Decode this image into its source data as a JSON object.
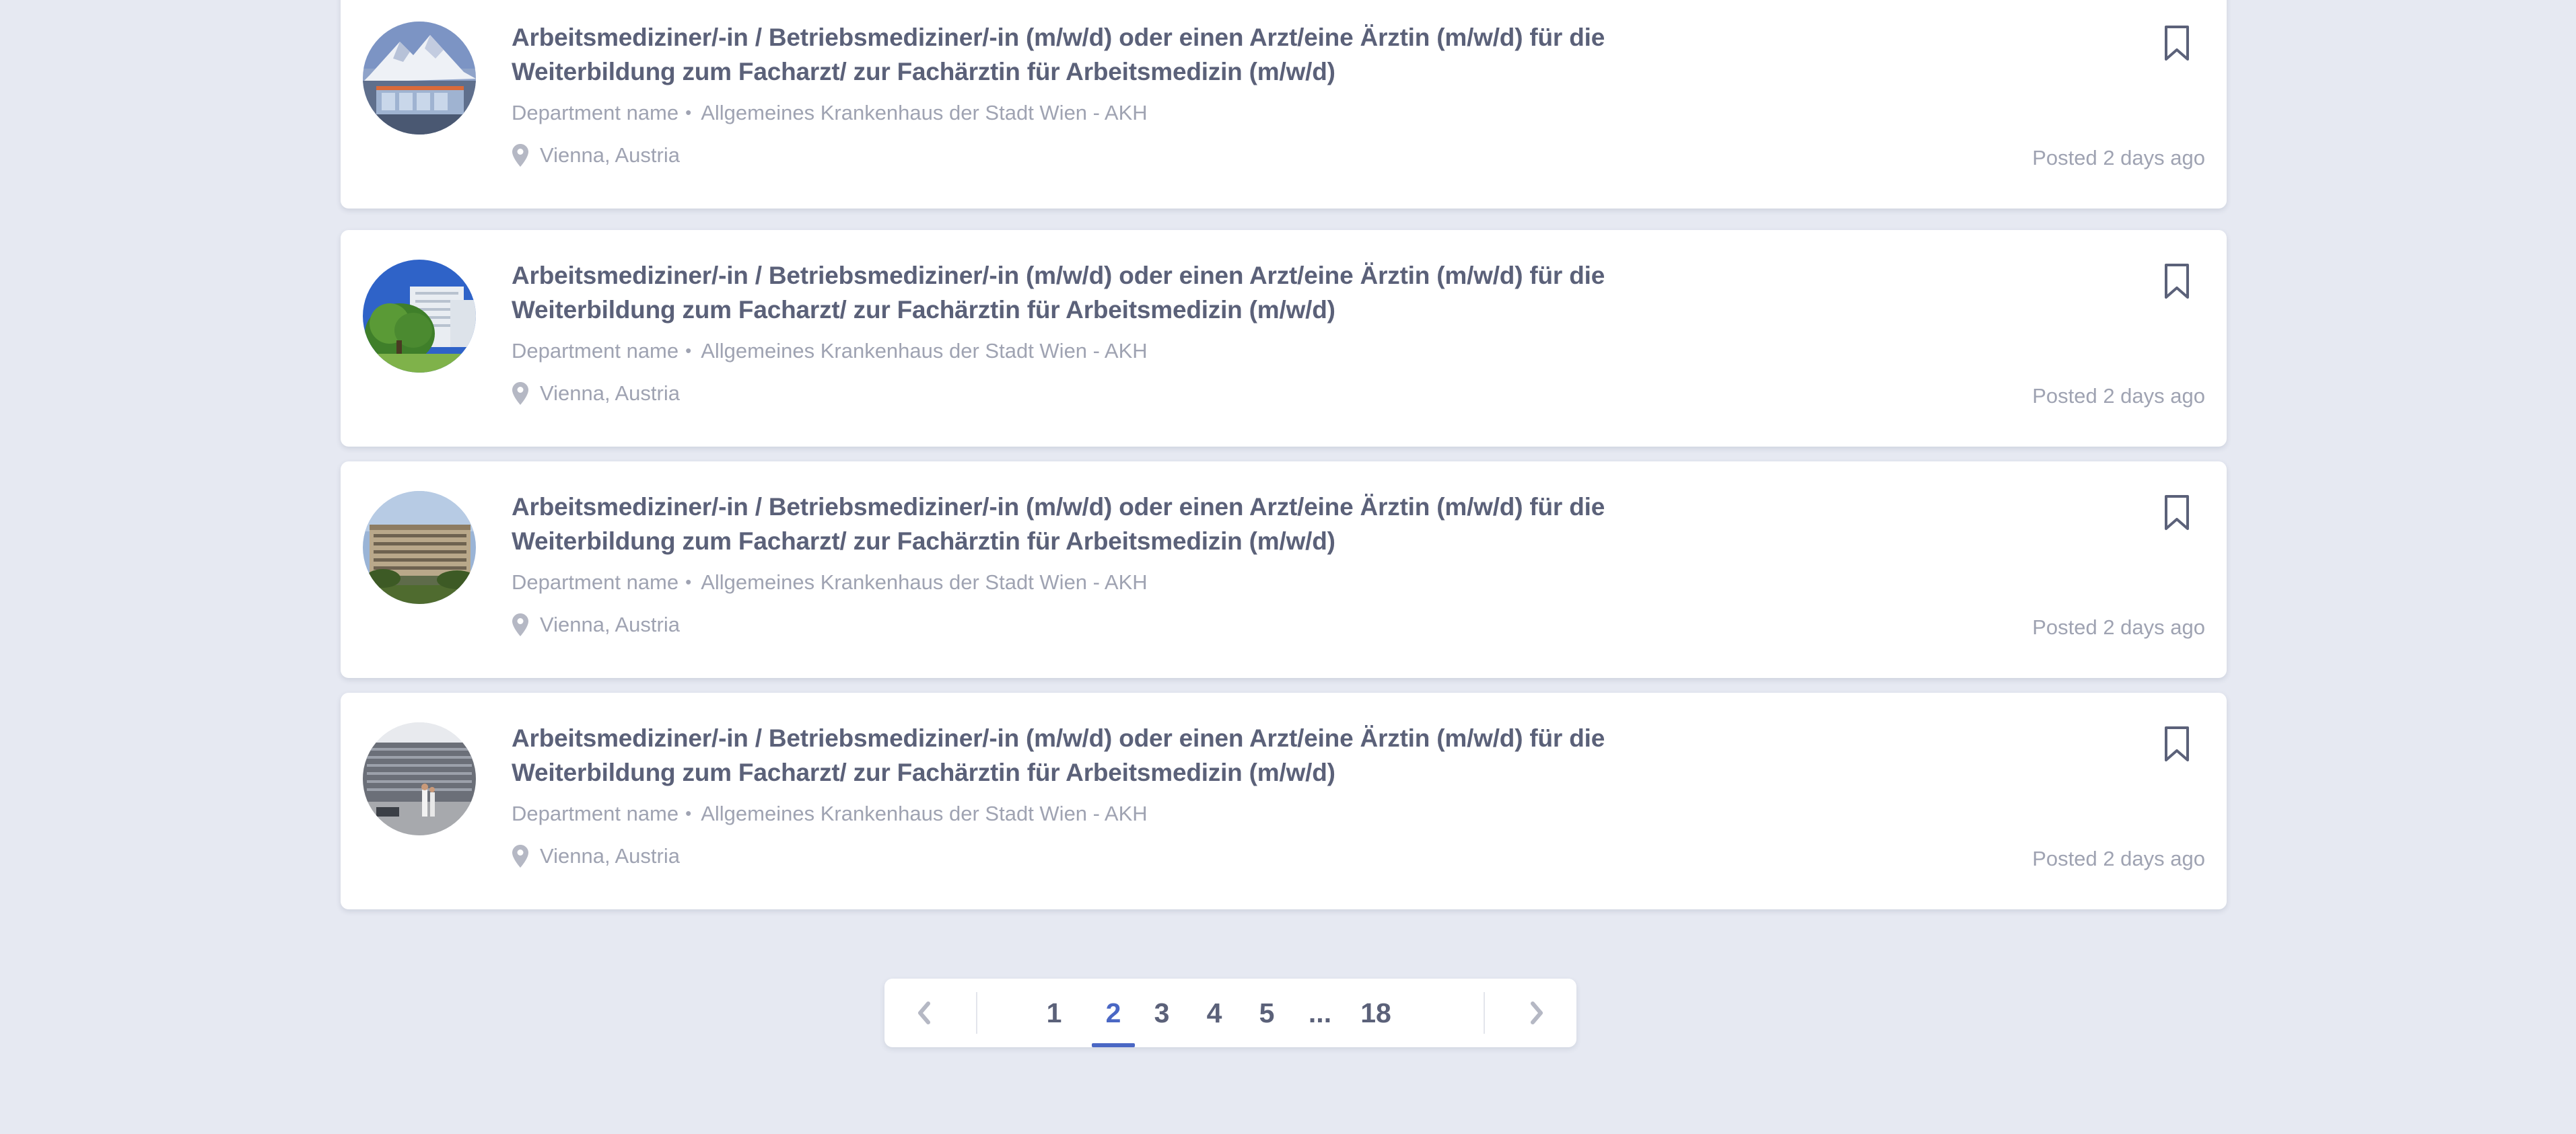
{
  "jobs": [
    {
      "title": "Arbeitsmediziner/-in / Betriebsmediziner/-in (m/w/d) oder einen Arzt/eine Ärztin (m/w/d) für die Weiterbildung zum Facharzt/ zur Fachärztin für Arbeitsmedizin (m/w/d)",
      "department": "Department name",
      "organization": "Allgemeines Krankenhaus der Stadt Wien - AKH",
      "location": "Vienna, Austria",
      "posted": "Posted 2 days ago"
    },
    {
      "title": "Arbeitsmediziner/-in / Betriebsmediziner/-in (m/w/d) oder einen Arzt/eine Ärztin (m/w/d) für die Weiterbildung zum Facharzt/ zur Fachärztin für Arbeitsmedizin (m/w/d)",
      "department": "Department name",
      "organization": "Allgemeines Krankenhaus der Stadt Wien - AKH",
      "location": "Vienna, Austria",
      "posted": "Posted 2 days ago"
    },
    {
      "title": "Arbeitsmediziner/-in / Betriebsmediziner/-in (m/w/d) oder einen Arzt/eine Ärztin (m/w/d) für die Weiterbildung zum Facharzt/ zur Fachärztin für Arbeitsmedizin (m/w/d)",
      "department": "Department name",
      "organization": "Allgemeines Krankenhaus der Stadt Wien - AKH",
      "location": "Vienna, Austria",
      "posted": "Posted 2 days ago"
    },
    {
      "title": "Arbeitsmediziner/-in / Betriebsmediziner/-in (m/w/d) oder einen Arzt/eine Ärztin (m/w/d) für die Weiterbildung zum Facharzt/ zur Fachärztin für Arbeitsmedizin (m/w/d)",
      "department": "Department name",
      "organization": "Allgemeines Krankenhaus der Stadt Wien - AKH",
      "location": "Vienna, Austria",
      "posted": "Posted 2 days ago"
    }
  ],
  "pagination": {
    "pages": [
      "1",
      "2",
      "3",
      "4",
      "5",
      "...",
      "18"
    ],
    "current": "2",
    "prev_icon": "chevron-left-icon",
    "next_icon": "chevron-right-icon"
  },
  "colors": {
    "background": "#e6e9f2",
    "card": "#ffffff",
    "title": "#5b6179",
    "muted": "#9fa3b2",
    "accent": "#4a67c4"
  }
}
